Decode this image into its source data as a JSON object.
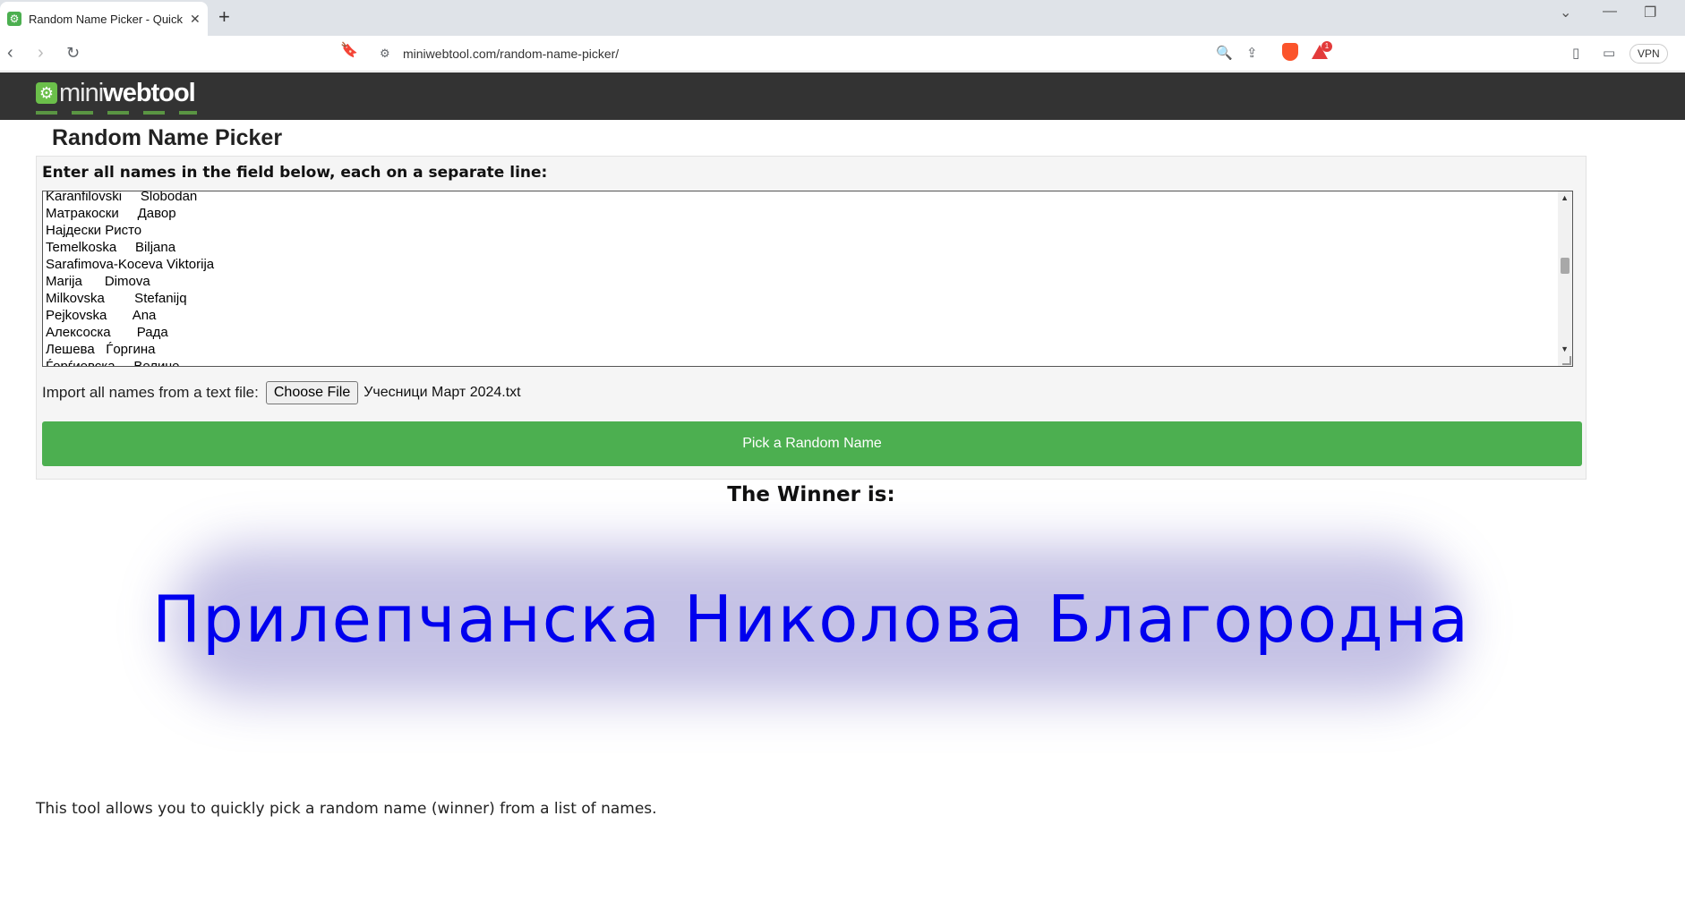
{
  "browser": {
    "tab_title": "Random Name Picker - Quickly",
    "tab_favicon": "gear-icon",
    "url": "miniwebtool.com/random-name-picker/",
    "reward_badge": "1",
    "vpn_label": "VPN"
  },
  "site": {
    "logo_light": "mini",
    "logo_bold": "webtool"
  },
  "page": {
    "title": "Random Name Picker",
    "form_label": "Enter all names in the field below, each on a separate line:",
    "names": [
      "Karanfilovski     Slobodan",
      "Матракоски     Давор",
      "Најдески Ристо",
      "Temelkoska     Biljana",
      "Sarafimova-Koceva Viktorija",
      "Marija      Dimova",
      "Milkovska        Stefanijq",
      "Pejkovska       Ana",
      "Алексоска       Рада",
      "Лешева   Ѓоргина",
      "Ѓорѓиевска     Величе"
    ],
    "import_label": "Import all names from a text file:",
    "choose_file_label": "Choose File",
    "file_name": "Учесници Март 2024.txt",
    "pick_button_label": "Pick a Random Name",
    "winner_label": "The Winner is:",
    "winner_name": "Прилепчанска Николова Благородна",
    "description": "This tool allows you to quickly pick a random name (winner) from a list of names."
  },
  "colors": {
    "accent_green": "#4caf50",
    "winner_blue": "#0000ee",
    "header_dark": "#333333"
  }
}
